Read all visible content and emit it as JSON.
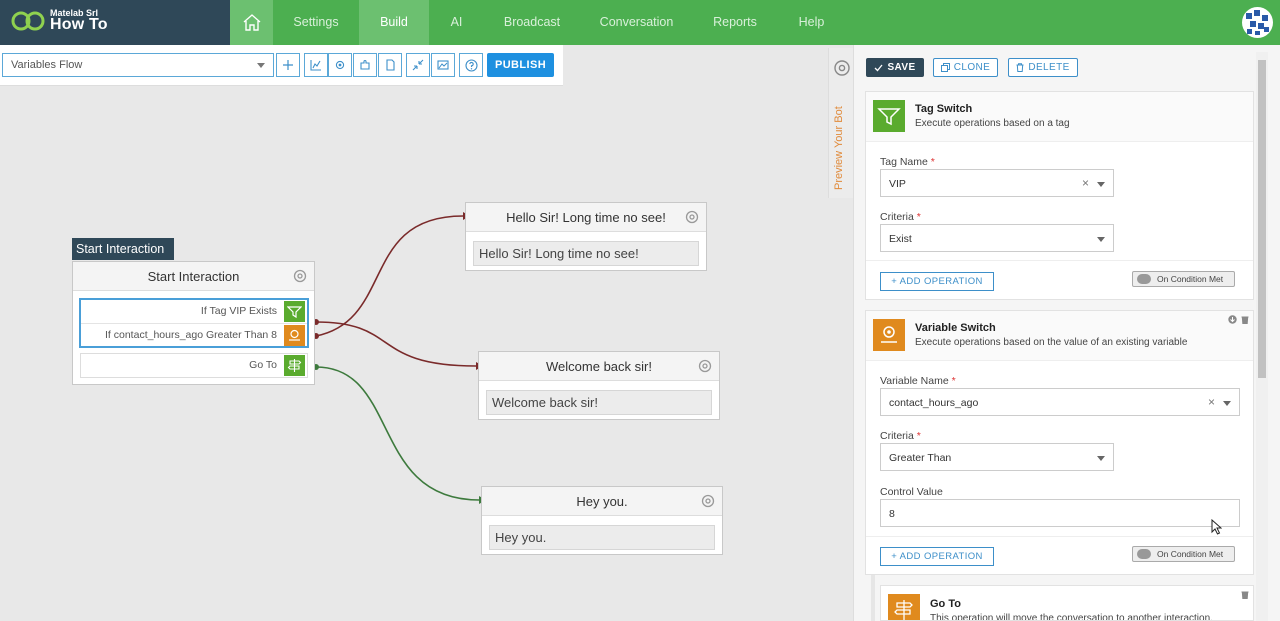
{
  "brand": {
    "company": "Matelab Srl",
    "project": "How To"
  },
  "nav": {
    "items": [
      {
        "label": "Settings",
        "active": false
      },
      {
        "label": "Build",
        "active": true
      },
      {
        "label": "AI",
        "active": false
      },
      {
        "label": "Broadcast",
        "active": false
      },
      {
        "label": "Conversation",
        "active": false
      },
      {
        "label": "Reports",
        "active": false
      },
      {
        "label": "Help",
        "active": false
      }
    ]
  },
  "toolbar": {
    "flow_name": "Variables Flow",
    "publish_label": "PUBLISH"
  },
  "canvas": {
    "start_tag": "Start Interaction",
    "start_node": {
      "title": "Start Interaction",
      "conditions": [
        "If Tag VIP Exists",
        "If contact_hours_ago Greater Than 8"
      ],
      "goto": "Go To"
    },
    "nodes": [
      {
        "title": "Hello Sir! Long time no see!",
        "body": "Hello Sir! Long time no see!"
      },
      {
        "title": "Welcome back sir!",
        "body": "Welcome back sir!"
      },
      {
        "title": "Hey you.",
        "body": "Hey you."
      }
    ]
  },
  "preview": {
    "label": "Preview Your Bot"
  },
  "panel": {
    "save_label": "SAVE",
    "clone_label": "CLONE",
    "delete_label": "DELETE",
    "tag_switch": {
      "title": "Tag Switch",
      "subtitle": "Execute operations based on a tag",
      "tag_name_label": "Tag Name",
      "tag_name_value": "VIP",
      "criteria_label": "Criteria",
      "criteria_value": "Exist",
      "add_operation": "+ ADD OPERATION",
      "on_condition": "On Condition Met"
    },
    "variable_switch": {
      "title": "Variable Switch",
      "subtitle": "Execute operations based on the value of an existing variable",
      "variable_label": "Variable Name",
      "variable_value": "contact_hours_ago",
      "criteria_label": "Criteria",
      "criteria_value": "Greater Than",
      "control_label": "Control Value",
      "control_value": "8",
      "add_operation": "+ ADD OPERATION",
      "on_condition": "On Condition Met"
    },
    "goto": {
      "title": "Go To",
      "subtitle": "This operation will move the conversation to another interaction."
    },
    "required_mark": "*",
    "clear_mark": "×"
  },
  "colors": {
    "topbar": "#4caf50",
    "brand": "#2f4858",
    "accent": "#1e90e0",
    "tag_icon": "#5aab2e",
    "var_icon": "#e08a1e"
  }
}
